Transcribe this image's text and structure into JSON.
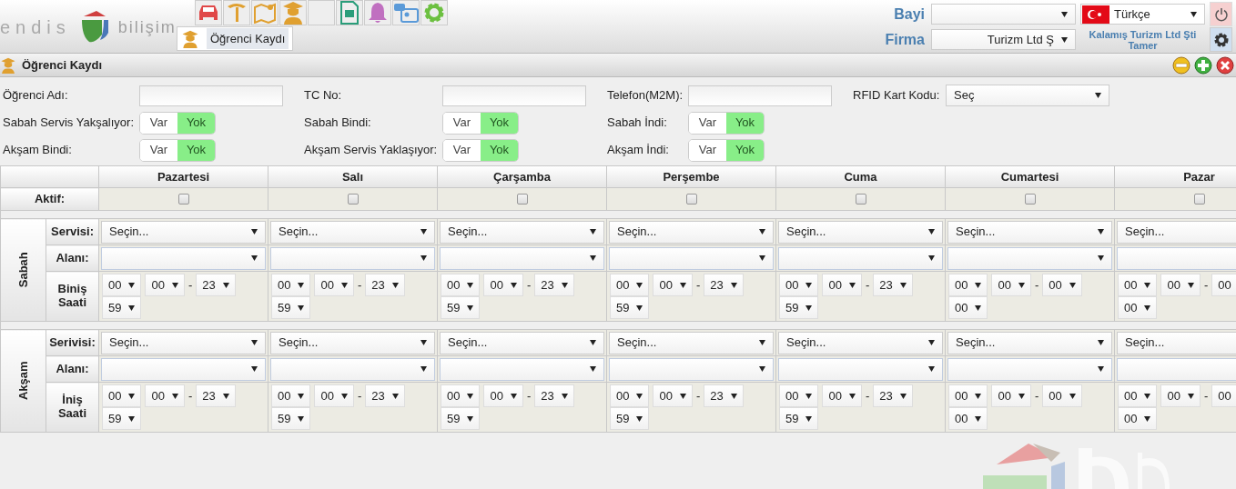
{
  "header": {
    "logo_text": [
      "endis",
      "bilişim"
    ],
    "tooltip": "Öğrenci Kaydı",
    "dealer_label": "Bayi",
    "language": "Türkçe",
    "company_label": "Firma",
    "company_value": "Turizm Ltd Ş",
    "user_company": "Kalamış Turizm Ltd Şti",
    "user_name": "Tamer"
  },
  "panel": {
    "title": "Öğrenci Kaydı"
  },
  "form": [
    [
      {
        "kind": "text",
        "label": "Öğrenci Adı:"
      },
      {
        "kind": "text",
        "label": "TC No:"
      },
      {
        "kind": "text",
        "label": "Telefon(M2M):"
      },
      {
        "kind": "select",
        "label": "RFID Kart Kodu:",
        "value": "Seç"
      }
    ],
    [
      {
        "kind": "toggle",
        "label": "Sabah Servis Yakşalıyor:",
        "options": [
          {
            "label": "Var",
            "selected": false
          },
          {
            "label": "Yok",
            "selected": true
          }
        ]
      },
      {
        "kind": "toggle",
        "label": "Sabah Bindi:",
        "options": [
          {
            "label": "Var",
            "selected": false
          },
          {
            "label": "Yok",
            "selected": true
          }
        ]
      },
      {
        "kind": "toggle",
        "label": "Sabah İndi:",
        "options": [
          {
            "label": "Var",
            "selected": false
          },
          {
            "label": "Yok",
            "selected": true
          }
        ]
      }
    ],
    [
      {
        "kind": "toggle",
        "label": "Akşam Bindi:",
        "options": [
          {
            "label": "Var",
            "selected": false
          },
          {
            "label": "Yok",
            "selected": true
          }
        ]
      },
      {
        "kind": "toggle",
        "label": "Akşam Servis Yaklaşıyor:",
        "options": [
          {
            "label": "Var",
            "selected": false
          },
          {
            "label": "Yok",
            "selected": true
          }
        ]
      },
      {
        "kind": "toggle",
        "label": "Akşam İndi:",
        "options": [
          {
            "label": "Var",
            "selected": false
          },
          {
            "label": "Yok",
            "selected": true
          }
        ]
      }
    ]
  ],
  "schedule": {
    "active_label": "Aktif:",
    "days": [
      {
        "name": "Pazartesi",
        "active": false
      },
      {
        "name": "Salı",
        "active": false
      },
      {
        "name": "Çarşamba",
        "active": false
      },
      {
        "name": "Perşembe",
        "active": false
      },
      {
        "name": "Cuma",
        "active": false
      },
      {
        "name": "Cumartesi",
        "active": false
      },
      {
        "name": "Pazar",
        "active": false
      }
    ],
    "sections": [
      {
        "title": "Sabah",
        "service_label": "Servisi:",
        "area_label": "Alanı:",
        "time_label": "Biniş Saati",
        "cells": [
          {
            "service": "Seçin...",
            "time": [
              "00",
              "00",
              "23",
              "59"
            ],
            "separator": "-"
          },
          {
            "service": "Seçin...",
            "time": [
              "00",
              "00",
              "23",
              "59"
            ],
            "separator": "-"
          },
          {
            "service": "Seçin...",
            "time": [
              "00",
              "00",
              "23",
              "59"
            ],
            "separator": "-"
          },
          {
            "service": "Seçin...",
            "time": [
              "00",
              "00",
              "23",
              "59"
            ],
            "separator": "-"
          },
          {
            "service": "Seçin...",
            "time": [
              "00",
              "00",
              "23",
              "59"
            ],
            "separator": "-"
          },
          {
            "service": "Seçin...",
            "time": [
              "00",
              "00",
              "00",
              "00"
            ],
            "separator": "-"
          },
          {
            "service": "Seçin...",
            "time": [
              "00",
              "00",
              "00",
              "00"
            ],
            "separator": "-"
          }
        ]
      },
      {
        "title": "Akşam",
        "service_label": "Serivisi:",
        "area_label": "Alanı:",
        "time_label": "İniş Saati",
        "cells": [
          {
            "service": "Seçin...",
            "time": [
              "00",
              "00",
              "23",
              "59"
            ],
            "separator": "-"
          },
          {
            "service": "Seçin...",
            "time": [
              "00",
              "00",
              "23",
              "59"
            ],
            "separator": "-"
          },
          {
            "service": "Seçin...",
            "time": [
              "00",
              "00",
              "23",
              "59"
            ],
            "separator": "-"
          },
          {
            "service": "Seçin...",
            "time": [
              "00",
              "00",
              "23",
              "59"
            ],
            "separator": "-"
          },
          {
            "service": "Seçin...",
            "time": [
              "00",
              "00",
              "23",
              "59"
            ],
            "separator": "-"
          },
          {
            "service": "Seçin...",
            "time": [
              "00",
              "00",
              "00",
              "00"
            ],
            "separator": "-"
          },
          {
            "service": "Seçin...",
            "time": [
              "00",
              "00",
              "00",
              "00"
            ],
            "separator": "-"
          }
        ]
      }
    ]
  }
}
